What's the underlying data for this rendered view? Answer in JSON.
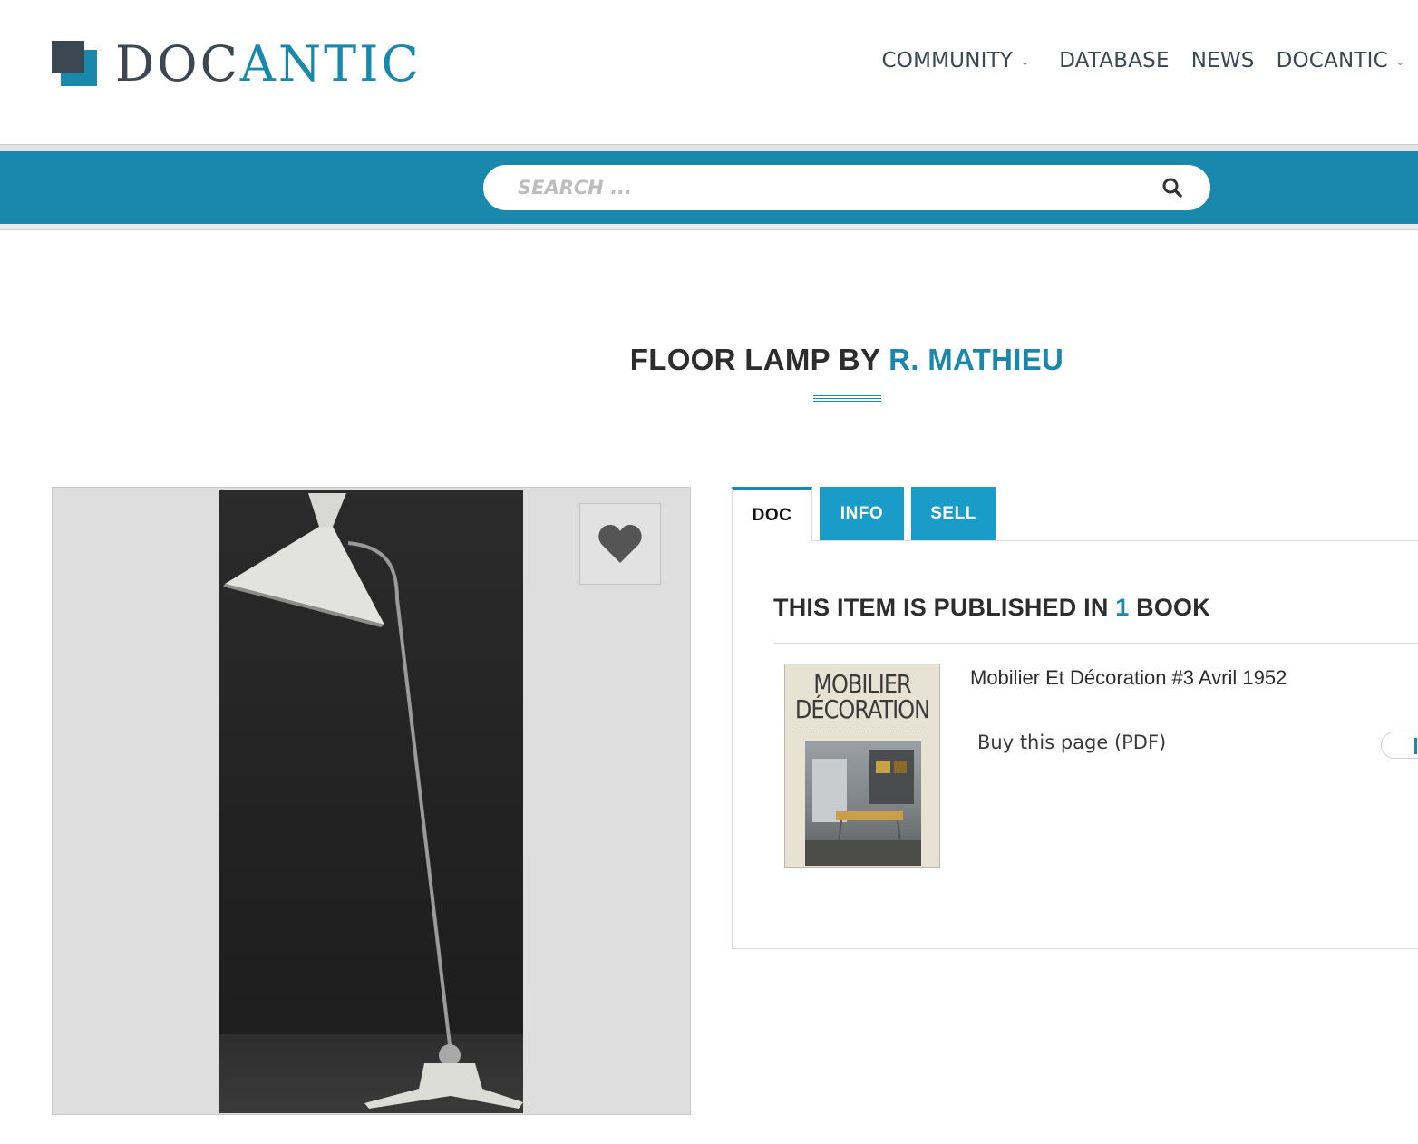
{
  "brand": {
    "logo_text_a": "DOC",
    "logo_text_b": "ANTIC",
    "logo_alt": "DOCANTIC",
    "accent_color": "#1a87ad",
    "dark_color": "#3b4751"
  },
  "nav": {
    "items": [
      {
        "label": "COMMUNITY",
        "has_dropdown": true
      },
      {
        "label": "DATABASE",
        "has_dropdown": false
      },
      {
        "label": "NEWS",
        "has_dropdown": false
      },
      {
        "label": "DOCANTIC",
        "has_dropdown": true
      }
    ]
  },
  "search": {
    "placeholder": "SEARCH ...",
    "value": "",
    "icon": "search-icon"
  },
  "page": {
    "title_prefix": "FLOOR LAMP BY",
    "title_author": "R. MATHIEU"
  },
  "image_panel": {
    "favorite_icon": "heart-icon"
  },
  "tabs": [
    {
      "label": "DOC",
      "active": true
    },
    {
      "label": "INFO",
      "active": false
    },
    {
      "label": "SELL",
      "active": false
    }
  ],
  "publications": {
    "heading_prefix": "THIS ITEM IS PUBLISHED IN",
    "count": "1",
    "heading_suffix": "BOOK",
    "books": [
      {
        "title": "Mobilier Et Décoration #3 Avril 1952",
        "cover_line1": "MOBILIER",
        "cover_line2": "DÉCORATION",
        "buy_label": "Buy this page (PDF)"
      }
    ]
  }
}
